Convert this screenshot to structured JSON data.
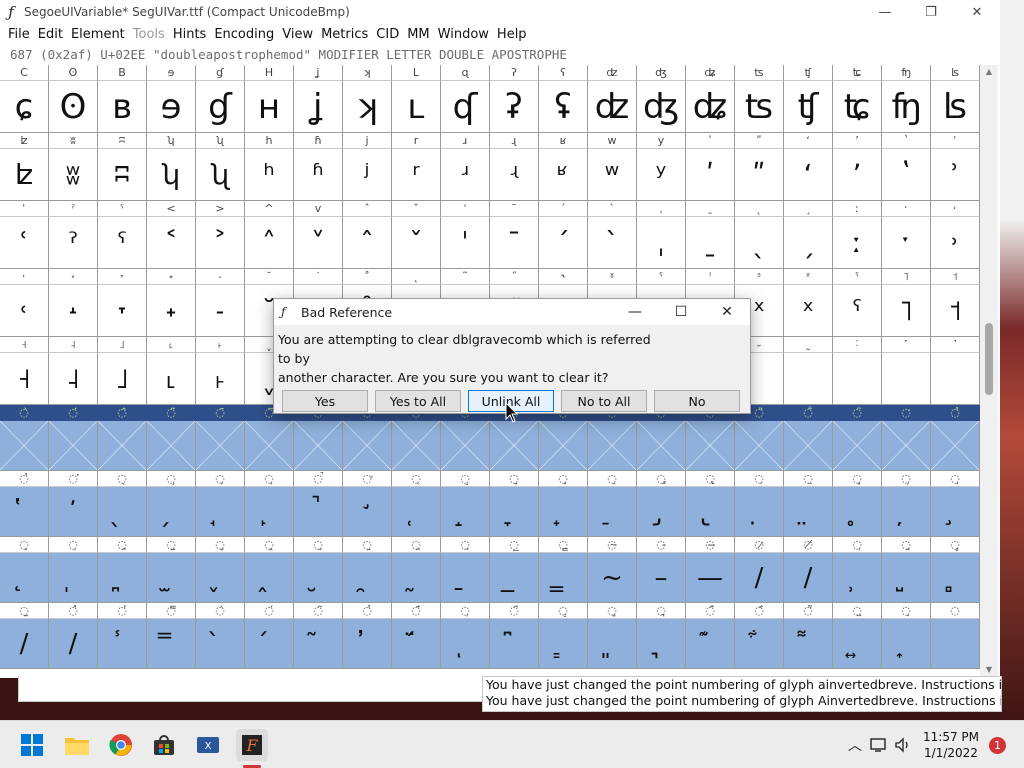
{
  "window": {
    "title": "SegoeUIVariable*  SegUIVar.ttf (Compact UnicodeBmp)",
    "controls": {
      "minimize": "—",
      "maximize": "❐",
      "close": "✕"
    }
  },
  "menu": [
    "File",
    "Edit",
    "Element",
    "Tools",
    "Hints",
    "Encoding",
    "View",
    "Metrics",
    "CID",
    "MM",
    "Window",
    "Help"
  ],
  "menu_disabled": [
    "Tools"
  ],
  "info_line": "687 (0x2af) U+02EE \"doublea­postrophemod\" MODIFIER LETTER DOUBLE APOSTROPHE",
  "grid": {
    "rows": [
      {
        "labels": [
          "C",
          "ʘ",
          "B",
          "ɘ",
          "ɠ",
          "H",
          "ʝ",
          "ʞ",
          "L",
          "ɋ",
          "ʔ",
          "ʕ",
          "ʣ",
          "ʤ",
          "ʥ",
          "ʦ",
          "ʧ",
          "ʨ",
          "ʩ",
          "ʪ"
        ],
        "glyphs": [
          "ɕ",
          "ʘ",
          "ʙ",
          "ɘ",
          "ɠ",
          "ʜ",
          "ʝ",
          "ʞ",
          "ʟ",
          "ʠ",
          "ʡ",
          "ʢ",
          "ʣ",
          "ʤ",
          "ʥ",
          "ʦ",
          "ʧ",
          "ʨ",
          "ʩ",
          "ʪ"
        ]
      },
      {
        "labels": [
          "ʫ",
          "ʬ",
          "ʭ",
          "ʮ",
          "ʯ",
          "h",
          "ɦ",
          "j",
          "r",
          "ɹ",
          "ɻ",
          "ʁ",
          "w",
          "y",
          "ʹ",
          "ʺ",
          "ʻ",
          "ʼ",
          "ʽ",
          "ʾ"
        ],
        "glyphs": [
          "ʫ",
          "ʬ",
          "ʭ",
          "ʮ",
          "ʯ",
          "ʰ",
          "ʱ",
          "ʲ",
          "ʳ",
          "ʴ",
          "ʵ",
          "ʶ",
          "ʷ",
          "ʸ",
          "ʹ",
          "ʺ",
          "ʻ",
          "ʼ",
          "ʽ",
          "ʾ"
        ]
      },
      {
        "labels": [
          "ʿ",
          "ˀ",
          "ˁ",
          "<",
          ">",
          "^",
          "v",
          "ˆ",
          "ˇ",
          "ˈ",
          "ˉ",
          "ˊ",
          "ˋ",
          "ˌ",
          "ˍ",
          "ˎ",
          "ˏ",
          "ː",
          "ˑ",
          "˒"
        ],
        "glyphs": [
          "ʿ",
          "ˀ",
          "ˁ",
          "˂",
          "˃",
          "˄",
          "˅",
          "ˆ",
          "ˇ",
          "ˈ",
          "ˉ",
          "ˊ",
          "ˋ",
          "ˌ",
          "ˍ",
          "ˎ",
          "ˏ",
          "ː",
          "ˑ",
          "˒"
        ]
      },
      {
        "labels": [
          "˓",
          "˔",
          "˕",
          "˖",
          "˗",
          "˘",
          "˙",
          "˚",
          "˛",
          "˜",
          "˝",
          "˞",
          "ˠ",
          "ˤ",
          "ˡ",
          "ˢ",
          "ˣ",
          "ˤ",
          "˥",
          "˦"
        ],
        "glyphs": [
          "˓",
          "˔",
          "˕",
          "˖",
          "˗",
          "˘",
          "˙",
          "˚",
          "˛",
          "˜",
          "˝",
          "˞",
          "ˠ",
          "ˡ",
          "ˢ",
          "ˣ",
          "ˣ",
          "ˤ",
          "˥",
          "˦"
        ]
      },
      {
        "labels": [
          "˧",
          "˨",
          "˩",
          "˪",
          "˫",
          "ˬ",
          "˭",
          "ˮ",
          "˯",
          "˰",
          "˱",
          "˲",
          "˳",
          "˴",
          "˵",
          "˶",
          "˷",
          "˸",
          "˹",
          "˺"
        ],
        "glyphs": [
          "˧",
          "˨",
          "˩",
          "˪",
          "˫",
          "ˬ",
          "˭",
          "ˮ",
          "",
          "",
          "",
          "",
          "",
          "",
          "",
          "",
          "",
          "",
          "",
          ""
        ]
      }
    ],
    "selected_row_labels": [
      "◌̀",
      "◌́",
      "◌̂",
      "◌̃",
      "◌̄",
      "◌̅",
      "◌̆",
      "◌̇",
      "◌̈",
      "◌̉",
      "◌̊",
      "◌̋",
      "◌̌",
      "◌̍",
      "◌̎",
      "◌̏",
      "◌̐",
      "◌̑",
      "◌̒",
      "◌̓"
    ],
    "combining_rows": [
      {
        "labels": [
          "◌̔",
          "◌̕",
          "◌̖",
          "◌̗",
          "◌̘",
          "◌̙",
          "◌̚",
          "◌̛",
          "◌̜",
          "◌̝",
          "◌̞",
          "◌̟",
          "◌̠",
          "◌̡",
          "◌̢",
          "◌̣",
          "◌̤",
          "◌̥",
          "◌̦",
          "◌̧"
        ],
        "glyphs": [
          "̔",
          "̕",
          "̖",
          "̗",
          "̘",
          "̙",
          "̚",
          "̛",
          "̜",
          "̝",
          "̞",
          "̟",
          "̠",
          "̡",
          "̢",
          "̣",
          "̤",
          "̥",
          "̦",
          "̧"
        ]
      },
      {
        "labels": [
          "◌̨",
          "◌̩",
          "◌̪",
          "◌̫",
          "◌̬",
          "◌̭",
          "◌̮",
          "◌̯",
          "◌̰",
          "◌̱",
          "◌̲",
          "◌̳",
          "◌̴",
          "◌̵",
          "◌̶",
          "◌̷",
          "◌̸",
          "◌̹",
          "◌̺",
          "◌̻"
        ],
        "glyphs": [
          "̨",
          "̩",
          "̪",
          "̫",
          "̬",
          "̭",
          "̮",
          "̯",
          "̰",
          "̱",
          "̲",
          "̳",
          "~",
          "–",
          "—",
          "/",
          "/",
          "̹",
          "̺",
          "̻"
        ]
      },
      {
        "labels": [
          "◌̼",
          "◌̽",
          "◌̾",
          "◌̿",
          "◌̀",
          "◌́",
          "◌͂",
          "◌̓",
          "◌̈́",
          "◌ͅ",
          "◌͆",
          "◌͇",
          "◌͈",
          "◌͉",
          "◌͊",
          "◌͋",
          "◌͌",
          "◌͍",
          "◌͎",
          "◌͏"
        ],
        "glyphs": [
          "/",
          "/",
          "̾",
          "̿",
          "̀",
          "́",
          "͂",
          "̓",
          "̈́",
          "ͅ",
          "͆",
          "͇",
          "͈",
          "͉",
          "͊",
          "͋",
          "͌",
          "͍",
          "͎",
          "͏"
        ]
      }
    ]
  },
  "dialog": {
    "title": "Bad Reference",
    "lines": [
      "You are attempting to clear dblgravecomb which is referred",
      "to by",
      "another character. Are you sure you want to clear it?"
    ],
    "buttons": [
      "Yes",
      "Yes to All",
      "Unlink All",
      "No to All",
      "No"
    ],
    "focused_button": "Unlink All"
  },
  "output": {
    "lines": [
      "You have just changed the point numbering of glyph ainvertedbreve. Instructions in this g",
      "You have just changed the point numbering of glyph Ainvertedbreve. Instructions in this g"
    ]
  },
  "taskbar": {
    "apps": [
      "windows-start-icon",
      "file-explorer-icon",
      "chrome-icon",
      "microsoft-store-icon",
      "xlaunch-icon",
      "fontforge-icon"
    ],
    "time": "11:57 PM",
    "date": "1/1/2022",
    "notifications": "1"
  },
  "colors": {
    "selection": "#8fb0da",
    "selected_row": "#2f4f8a",
    "accent": "#0078d7"
  }
}
